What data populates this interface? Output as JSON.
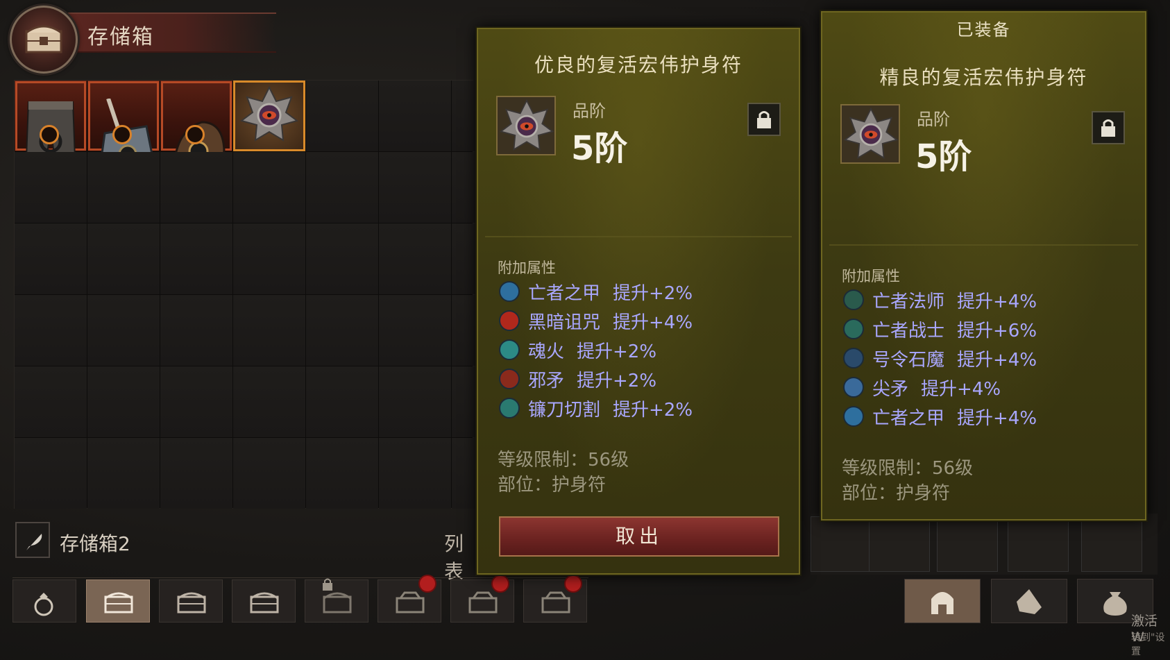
{
  "stash": {
    "title": "存储箱",
    "name": "存储箱2",
    "list_label": "列表"
  },
  "grid": {
    "items": [
      {
        "name": "legendary-pants",
        "rarity": "legendary"
      },
      {
        "name": "legendary-helm-horned",
        "rarity": "legendary"
      },
      {
        "name": "legendary-gloves",
        "rarity": "legendary"
      },
      {
        "name": "amulet-of-resurrection",
        "rarity": "selected"
      }
    ]
  },
  "tabs": [
    {
      "icon": "ring-icon",
      "active": false
    },
    {
      "icon": "chest-icon",
      "active": true
    },
    {
      "icon": "chest-icon",
      "active": false
    },
    {
      "icon": "chest-icon",
      "active": false
    },
    {
      "icon": "chest-icon",
      "active": false,
      "locked": true
    },
    {
      "icon": "chest-timed-icon",
      "active": false,
      "timer": true
    },
    {
      "icon": "chest-timed-icon",
      "active": false,
      "timer": true
    },
    {
      "icon": "chest-timed-icon",
      "active": false,
      "timer": true
    }
  ],
  "tooltip_left": {
    "name": "优良的复活宏伟护身符",
    "rank_label": "品阶",
    "rank_value": "5阶",
    "section_label": "附加属性",
    "affixes": [
      {
        "name": "亡者之甲",
        "bonus": "提升+2%",
        "color": "#2e6f9e"
      },
      {
        "name": "黑暗诅咒",
        "bonus": "提升+4%",
        "color": "#b0281c"
      },
      {
        "name": "魂火",
        "bonus": "提升+2%",
        "color": "#2c8a86"
      },
      {
        "name": "邪矛",
        "bonus": "提升+2%",
        "color": "#8a2a1c"
      },
      {
        "name": "镰刀切割",
        "bonus": "提升+2%",
        "color": "#2a7a70"
      }
    ],
    "level_req": "等级限制：56级",
    "slot": "部位：护身符",
    "take_out_button": "取出"
  },
  "tooltip_right": {
    "equipped_label": "已装备",
    "name": "精良的复活宏伟护身符",
    "rank_label": "品阶",
    "rank_value": "5阶",
    "section_label": "附加属性",
    "affixes": [
      {
        "name": "亡者法师",
        "bonus": "提升+4%",
        "color": "#2a5a4c"
      },
      {
        "name": "亡者战士",
        "bonus": "提升+6%",
        "color": "#2a6a5c"
      },
      {
        "name": "号令石魔",
        "bonus": "提升+4%",
        "color": "#2a4a6a"
      },
      {
        "name": "尖矛",
        "bonus": "提升+4%",
        "color": "#3a6a9a"
      },
      {
        "name": "亡者之甲",
        "bonus": "提升+4%",
        "color": "#2e6f9e"
      }
    ],
    "level_req": "等级限制：56级",
    "slot": "部位：护身符"
  },
  "watermark": {
    "line1": "激活 W",
    "line2": "转到\"设置"
  }
}
